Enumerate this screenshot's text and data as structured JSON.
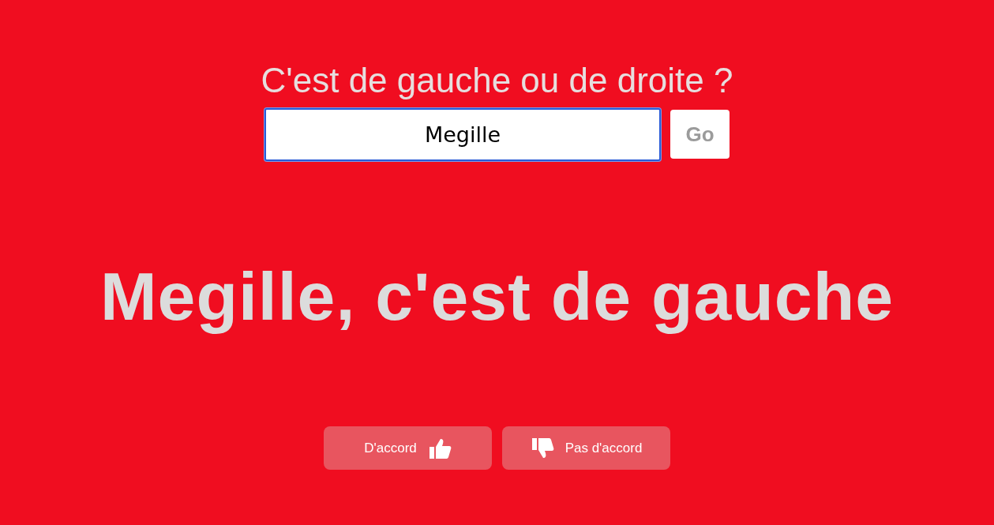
{
  "question": "C'est de gauche ou de droite ?",
  "search": {
    "value": "Megille",
    "focused": true
  },
  "go_button": "Go",
  "result": "Megille, c'est de gauche",
  "feedback_buttons": [
    {
      "label": "D'accord",
      "kind": "agree"
    },
    {
      "label": "Pas d'accord",
      "kind": "disagree"
    }
  ]
}
